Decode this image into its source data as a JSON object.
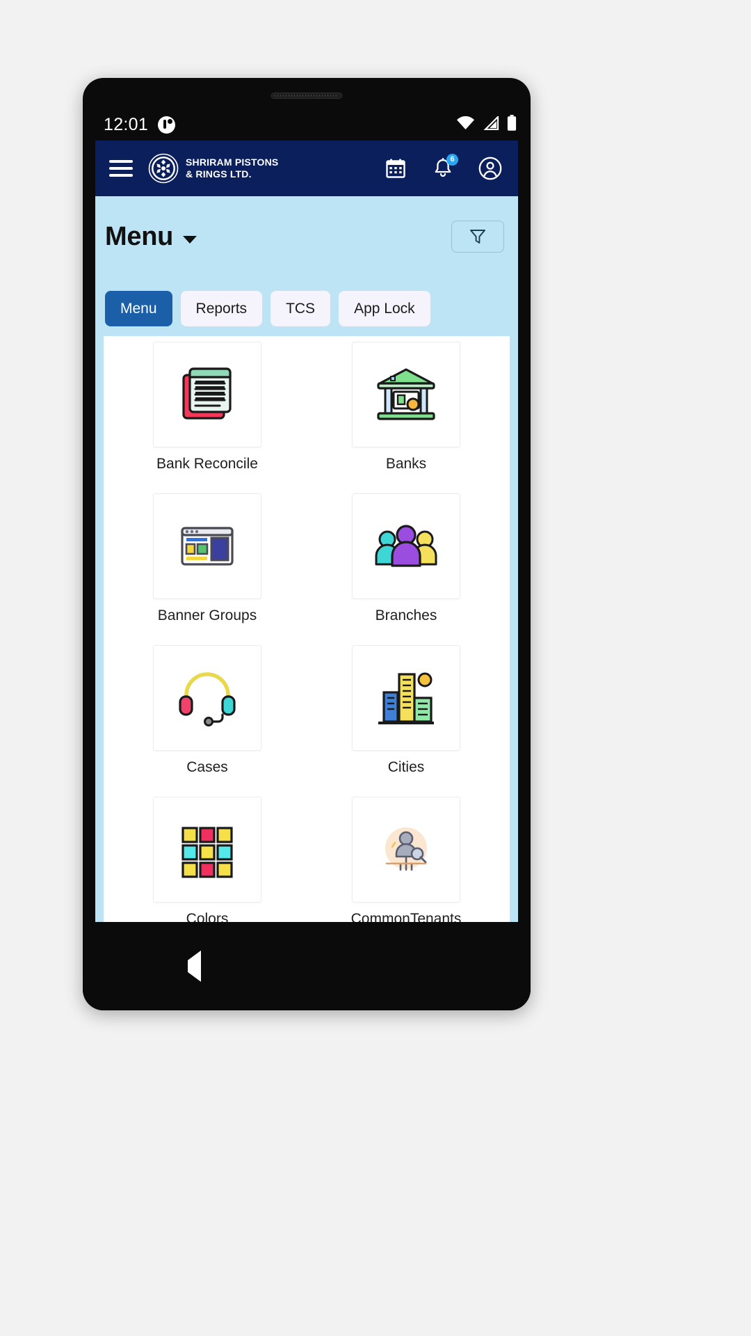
{
  "status_bar": {
    "time": "12:01",
    "app_icon": "app-notification-icon",
    "wifi_icon": "wifi-icon",
    "signal_icon": "cellular-signal-icon",
    "battery_icon": "battery-full-icon"
  },
  "app_bar": {
    "menu_icon": "hamburger-menu-icon",
    "logo_icon": "shriram-logo-icon",
    "brand_name": "SHRIRAM PISTONS\n& RINGS LTD.",
    "calendar_icon": "calendar-icon",
    "notifications_icon": "bell-icon",
    "notifications_badge": "6",
    "profile_icon": "account-circle-icon",
    "background_color": "#0a1f5c"
  },
  "title_bar": {
    "title": "Menu",
    "caret_icon": "chevron-down-icon",
    "filter_icon": "filter-funnel-icon",
    "background_color": "#bde4f4"
  },
  "tabs": [
    {
      "label": "Menu",
      "active": true
    },
    {
      "label": "Reports",
      "active": false
    },
    {
      "label": "TCS",
      "active": false
    },
    {
      "label": "App Lock",
      "active": false
    }
  ],
  "tab_colors": {
    "active_bg": "#1b5fa8",
    "inactive_bg": "#f5f3fb"
  },
  "grid_items": [
    {
      "label": "Bank Reconcile",
      "icon": "bank-reconcile-icon"
    },
    {
      "label": "Banks",
      "icon": "bank-building-icon"
    },
    {
      "label": "Banner Groups",
      "icon": "banner-groups-icon"
    },
    {
      "label": "Branches",
      "icon": "people-group-icon"
    },
    {
      "label": "Cases",
      "icon": "headset-support-icon"
    },
    {
      "label": "Cities",
      "icon": "city-skyline-icon"
    },
    {
      "label": "Colors",
      "icon": "color-swatch-grid-icon"
    },
    {
      "label": "CommonTenants",
      "icon": "common-tenants-icon"
    },
    {
      "label": "",
      "icon": "partial-row-icon-left"
    },
    {
      "label": "",
      "icon": "partial-row-icon-right"
    }
  ],
  "nav_bar": {
    "back_icon": "back-triangle-icon",
    "home_icon": "home-circle-icon",
    "recents_icon": "recents-square-icon"
  }
}
